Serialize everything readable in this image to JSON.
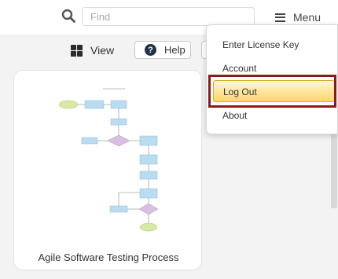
{
  "header": {
    "search_placeholder": "Find",
    "menu_label": "Menu"
  },
  "toolbar": {
    "view_label": "View",
    "help_label": "Help"
  },
  "card": {
    "title": "Agile Software Testing Process"
  },
  "menu": {
    "items": [
      {
        "label": "Enter License Key"
      },
      {
        "label": "Account"
      },
      {
        "label": "Log Out",
        "selected": true
      },
      {
        "label": "About"
      }
    ]
  },
  "colors": {
    "highlight_border": "#8c1a1a",
    "selected_item_fill": "#ffd66b",
    "help_icon_fill": "#20324a"
  }
}
